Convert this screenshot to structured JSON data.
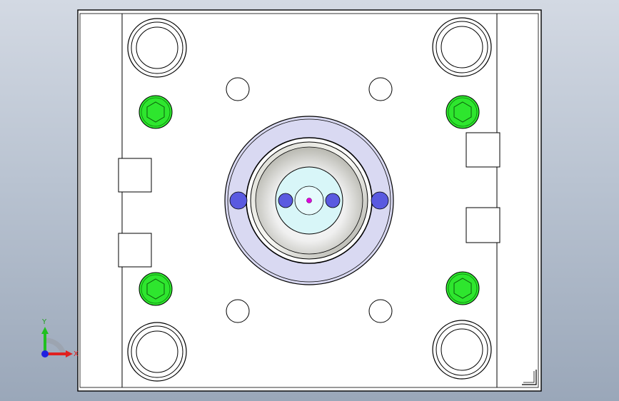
{
  "triad": {
    "x_label": "X",
    "y_label": "Y"
  },
  "colors": {
    "plate_fill": "#ffffff",
    "plate_stroke": "#000000",
    "screw_fill": "#2ee62e",
    "screw_stroke": "#0a7a0a",
    "ring_fill": "#d9d9f2",
    "pin_fill": "#5a5ae0",
    "bore_fill": "#d8f6f8",
    "center_dot": "#e000e0",
    "axis_x": "#e02020",
    "axis_y": "#20c020",
    "axis_z": "#2020e0"
  }
}
